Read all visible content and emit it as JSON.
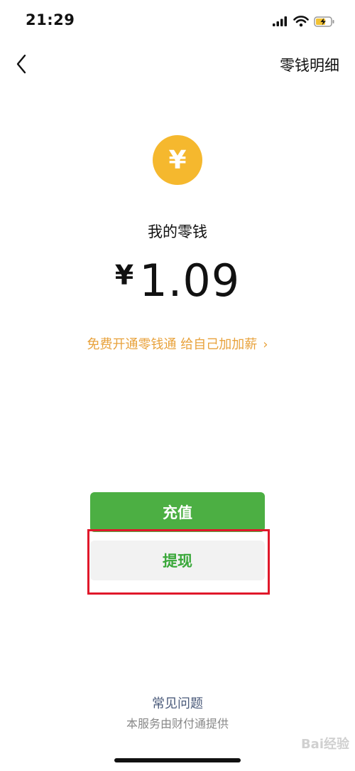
{
  "status_bar": {
    "time": "21:29"
  },
  "nav": {
    "back_icon": "chevron-left-icon",
    "action_label": "零钱明细"
  },
  "wallet": {
    "coin_symbol": "¥",
    "label": "我的零钱",
    "currency": "¥",
    "amount": "1.09",
    "promo_text": "免费开通零钱通 给自己加加薪",
    "promo_chevron": "›"
  },
  "actions": {
    "recharge_label": "充值",
    "withdraw_label": "提现"
  },
  "footer": {
    "faq_label": "常见问题",
    "provider_text": "本服务由财付通提供"
  },
  "watermark": {
    "text": "Bai经验"
  },
  "colors": {
    "coin": "#f5b82e",
    "promo": "#e8a23c",
    "primary_button": "#4caf43",
    "secondary_button_text": "#3aa83a",
    "highlight": "#e0182a",
    "faq": "#4a5a7a"
  }
}
